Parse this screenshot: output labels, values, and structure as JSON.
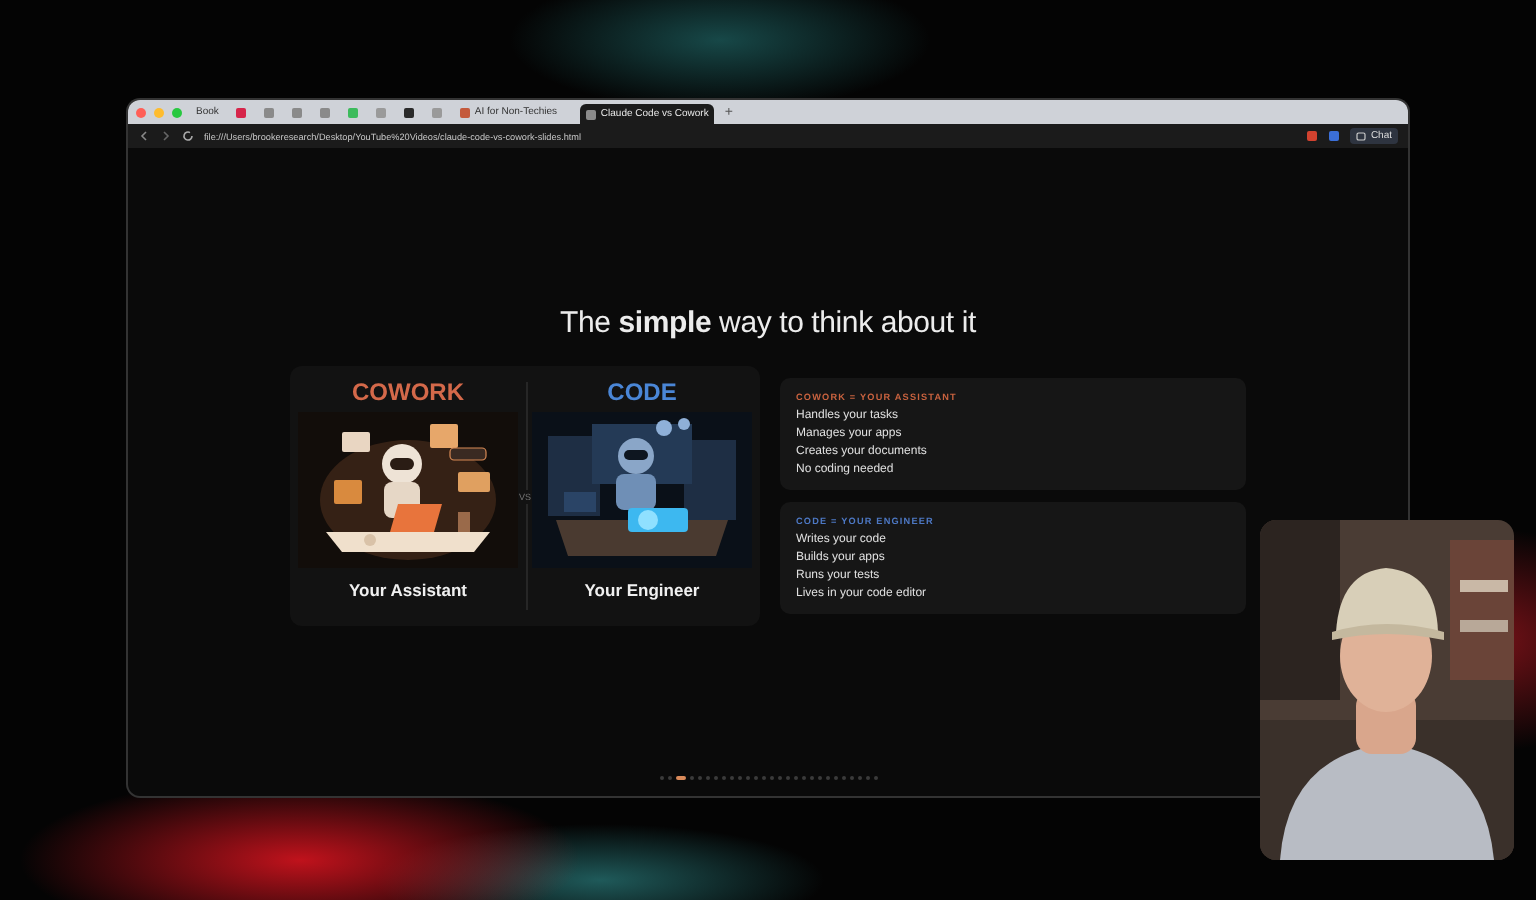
{
  "browser": {
    "tabs": [
      {
        "kind": "text",
        "label": "Book",
        "selected": false
      },
      {
        "kind": "icon",
        "color": "#d6254a",
        "selected": false
      },
      {
        "kind": "icon",
        "color": "#8a8a8a",
        "selected": false
      },
      {
        "kind": "icon",
        "color": "#8a8a8a",
        "selected": false
      },
      {
        "kind": "icon",
        "color": "#8a8a8a",
        "selected": false
      },
      {
        "kind": "icon",
        "color": "#3dbb5c",
        "selected": false
      },
      {
        "kind": "icon",
        "color": "#9a9a9a",
        "selected": false
      },
      {
        "kind": "icon",
        "color": "#2a2a2a",
        "selected": false
      },
      {
        "kind": "icon",
        "color": "#9a9a9a",
        "selected": false
      },
      {
        "kind": "page",
        "label": "AI for Non-Techies",
        "color": "#c45a3c",
        "selected": false
      },
      {
        "kind": "page",
        "label": "Claude Code vs Cowork",
        "color": "#8c8c8c",
        "selected": true
      }
    ],
    "new_tab": "+",
    "address": "file:///Users/brookeresearch/Desktop/YouTube%20Videos/claude-code-vs-cowork-slides.html",
    "chat_button": "Chat"
  },
  "slide": {
    "title": "The **simple** way to think about it",
    "sides": [
      {
        "heading": "COWORK",
        "caption": "Your Assistant",
        "color": "#d4694a"
      },
      {
        "heading": "CODE",
        "caption": "Your Engineer",
        "color": "#4a86d6"
      }
    ],
    "divider_label": "VS",
    "cards": [
      {
        "heading": "COWORK = YOUR ASSISTANT",
        "color": "#c8623f",
        "items": [
          "Handles your tasks",
          "Manages your apps",
          "Creates your documents",
          "No coding needed"
        ]
      },
      {
        "heading": "CODE = YOUR ENGINEER",
        "color": "#4d78c4",
        "items": [
          "Writes your code",
          "Builds your apps",
          "Runs your tests",
          "Lives in your code editor"
        ]
      }
    ],
    "progress_dots": [
      {
        "selected": false
      },
      {
        "selected": false
      },
      {
        "selected": true
      },
      {
        "selected": false
      },
      {
        "selected": false
      },
      {
        "selected": false
      },
      {
        "selected": false
      },
      {
        "selected": false
      },
      {
        "selected": false
      },
      {
        "selected": false
      },
      {
        "selected": false
      },
      {
        "selected": false
      },
      {
        "selected": false
      },
      {
        "selected": false
      },
      {
        "selected": false
      },
      {
        "selected": false
      },
      {
        "selected": false
      },
      {
        "selected": false
      },
      {
        "selected": false
      },
      {
        "selected": false
      },
      {
        "selected": false
      },
      {
        "selected": false
      },
      {
        "selected": false
      },
      {
        "selected": false
      },
      {
        "selected": false
      },
      {
        "selected": false
      },
      {
        "selected": false
      }
    ]
  }
}
